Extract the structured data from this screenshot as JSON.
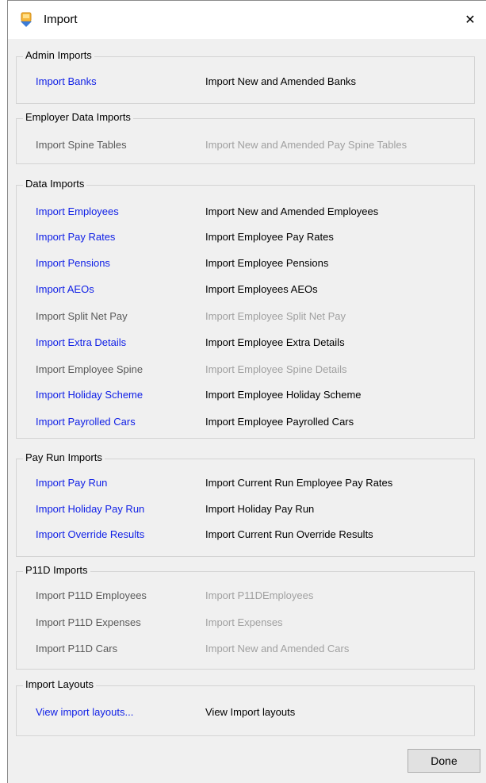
{
  "window": {
    "title": "Import",
    "close_glyph": "✕"
  },
  "groups": {
    "admin": {
      "legend": "Admin Imports",
      "rows": [
        {
          "link": "Import Banks",
          "desc": "Import New and Amended Banks",
          "enabled": true
        }
      ]
    },
    "employer": {
      "legend": "Employer Data Imports",
      "rows": [
        {
          "link": "Import Spine Tables",
          "desc": "Import New and Amended Pay Spine Tables",
          "enabled": false
        }
      ]
    },
    "data": {
      "legend": "Data Imports",
      "rows": [
        {
          "link": "Import Employees",
          "desc": "Import New and Amended Employees",
          "enabled": true
        },
        {
          "link": "Import Pay Rates",
          "desc": "Import Employee Pay Rates",
          "enabled": true
        },
        {
          "link": "Import Pensions",
          "desc": "Import Employee Pensions",
          "enabled": true
        },
        {
          "link": "Import AEOs",
          "desc": "Import Employees AEOs",
          "enabled": true
        },
        {
          "link": "Import Split Net Pay",
          "desc": "Import Employee Split Net Pay",
          "enabled": false
        },
        {
          "link": "Import Extra Details",
          "desc": "Import Employee Extra Details",
          "enabled": true
        },
        {
          "link": "Import Employee Spine",
          "desc": "Import Employee Spine Details",
          "enabled": false
        },
        {
          "link": "Import Holiday Scheme",
          "desc": "Import Employee Holiday Scheme",
          "enabled": true
        },
        {
          "link": "Import Payrolled Cars",
          "desc": "Import Employee Payrolled Cars",
          "enabled": true
        }
      ]
    },
    "payrun": {
      "legend": "Pay Run Imports",
      "rows": [
        {
          "link": "Import Pay Run",
          "desc": "Import Current Run Employee Pay Rates",
          "enabled": true
        },
        {
          "link": "Import Holiday Pay Run",
          "desc": "Import Holiday Pay Run",
          "enabled": true
        },
        {
          "link": "Import Override Results",
          "desc": "Import Current Run Override Results",
          "enabled": true
        }
      ]
    },
    "p11d": {
      "legend": "P11D Imports",
      "rows": [
        {
          "link": "Import P11D Employees",
          "desc": "Import P11DEmployees",
          "enabled": false
        },
        {
          "link": "Import P11D Expenses",
          "desc": "Import Expenses",
          "enabled": false
        },
        {
          "link": "Import P11D Cars",
          "desc": "Import New and Amended Cars",
          "enabled": false
        }
      ]
    },
    "layouts": {
      "legend": "Import Layouts",
      "rows": [
        {
          "link": "View import layouts...",
          "desc": "View Import layouts",
          "enabled": true
        }
      ]
    }
  },
  "buttons": {
    "done": "Done"
  },
  "colors": {
    "link": "#0e1ee6",
    "disabled_link": "#5a5a5a",
    "disabled_desc": "#a0a0a0",
    "dialog_bg": "#f0f0f0"
  }
}
